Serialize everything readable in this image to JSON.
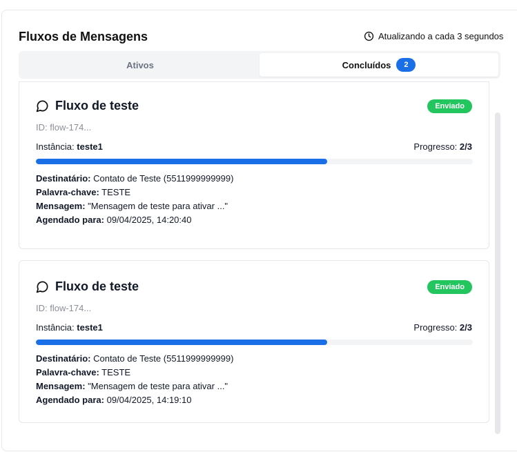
{
  "header": {
    "title": "Fluxos de Mensagens",
    "refresh_text": "Atualizando a cada 3 segundos"
  },
  "tabs": [
    {
      "label": "Ativos"
    },
    {
      "label": "Concluídos",
      "count": "2"
    }
  ],
  "flows": [
    {
      "name": "Fluxo de teste",
      "status": "Enviado",
      "id": "ID: flow-174...",
      "instance_label": "Instância:",
      "instance": "teste1",
      "progress_label": "Progresso:",
      "progress": "2/3",
      "progress_fraction": 0.667,
      "recipient_label": "Destinatário:",
      "recipient": "Contato de Teste (5511999999999)",
      "keyword_label": "Palavra-chave:",
      "keyword": "TESTE",
      "message_label": "Mensagem:",
      "message": "\"Mensagem de teste para ativar ...\"",
      "scheduled_label": "Agendado para:",
      "scheduled": "09/04/2025, 14:20:40"
    },
    {
      "name": "Fluxo de teste",
      "status": "Enviado",
      "id": "ID: flow-174...",
      "instance_label": "Instância:",
      "instance": "teste1",
      "progress_label": "Progresso:",
      "progress": "2/3",
      "progress_fraction": 0.667,
      "recipient_label": "Destinatário:",
      "recipient": "Contato de Teste (5511999999999)",
      "keyword_label": "Palavra-chave:",
      "keyword": "TESTE",
      "message_label": "Mensagem:",
      "message": "\"Mensagem de teste para ativar ...\"",
      "scheduled_label": "Agendado para:",
      "scheduled": "09/04/2025, 14:19:10"
    }
  ],
  "colors": {
    "accent": "#1a6fe6",
    "status_sent": "#22c55e"
  },
  "icons": {
    "refresh": "clock-icon",
    "flow": "message-circle-icon"
  }
}
